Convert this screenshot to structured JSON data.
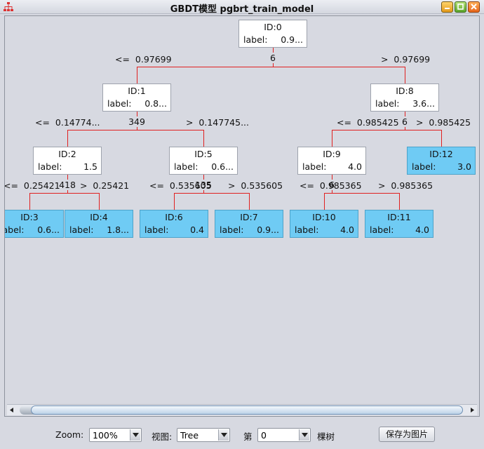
{
  "window": {
    "title": "GBDT模型 pgbrt_train_model"
  },
  "tree": {
    "nodes": [
      {
        "id": "ID:0",
        "label_key": "label:",
        "label_val": "0.9...",
        "leaf": false
      },
      {
        "id": "ID:1",
        "label_key": "label:",
        "label_val": "0.8...",
        "leaf": false
      },
      {
        "id": "ID:8",
        "label_key": "label:",
        "label_val": "3.6...",
        "leaf": false
      },
      {
        "id": "ID:2",
        "label_key": "label:",
        "label_val": "1.5",
        "leaf": false
      },
      {
        "id": "ID:5",
        "label_key": "label:",
        "label_val": "0.6...",
        "leaf": false
      },
      {
        "id": "ID:9",
        "label_key": "label:",
        "label_val": "4.0",
        "leaf": false
      },
      {
        "id": "ID:12",
        "label_key": "label:",
        "label_val": "3.0",
        "leaf": true
      },
      {
        "id": "ID:3",
        "label_key": "label:",
        "label_val": "0.6...",
        "leaf": true
      },
      {
        "id": "ID:4",
        "label_key": "label:",
        "label_val": "1.8...",
        "leaf": true
      },
      {
        "id": "ID:6",
        "label_key": "label:",
        "label_val": "0.4",
        "leaf": true
      },
      {
        "id": "ID:7",
        "label_key": "label:",
        "label_val": "0.9...",
        "leaf": true
      },
      {
        "id": "ID:10",
        "label_key": "label:",
        "label_val": "4.0",
        "leaf": true
      },
      {
        "id": "ID:11",
        "label_key": "label:",
        "label_val": "4.0",
        "leaf": true
      }
    ],
    "features": [
      "6",
      "349",
      "6",
      "418",
      "135",
      "6"
    ],
    "conditions": [
      "<=  0.97699",
      ">  0.97699",
      "<=  0.14774...",
      ">  0.147745...",
      "<=  0.985425",
      ">  0.985425",
      "<=  0.25421",
      ">  0.25421",
      "<=  0.535605",
      ">  0.535605",
      "<=  0.985365",
      ">  0.985365"
    ],
    "edge_color": "#e02020",
    "leaf_color": "#6fcbf4"
  },
  "toolbar": {
    "zoom_label": "Zoom:",
    "zoom_value": "100%",
    "view_label": "视图:",
    "view_value": "Tree",
    "tree_index_prefix": "第",
    "tree_index_value": "0",
    "tree_index_suffix": "棵树",
    "save_button": "保存为图片"
  }
}
